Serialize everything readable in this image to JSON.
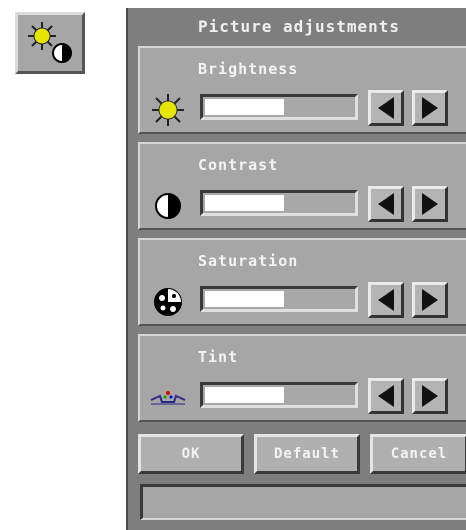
{
  "launcher": {
    "icon": "sun-contrast-icon"
  },
  "dialog": {
    "title": "Picture adjustments",
    "controls": [
      {
        "label": "Brightness",
        "icon": "sun-icon",
        "level": 0.52
      },
      {
        "label": "Contrast",
        "icon": "contrast-icon",
        "level": 0.52
      },
      {
        "label": "Saturation",
        "icon": "saturation-icon",
        "level": 0.52
      },
      {
        "label": "Tint",
        "icon": "tint-icon",
        "level": 0.52
      }
    ],
    "buttons": {
      "ok": "OK",
      "default": "Default",
      "cancel": "Cancel"
    },
    "status_text": ""
  },
  "colors": {
    "window_bg": "#7e7e7e",
    "panel_bg": "#a6a6a6",
    "sun_yellow": "#e6e600",
    "label_text": "#f4f4f4"
  }
}
